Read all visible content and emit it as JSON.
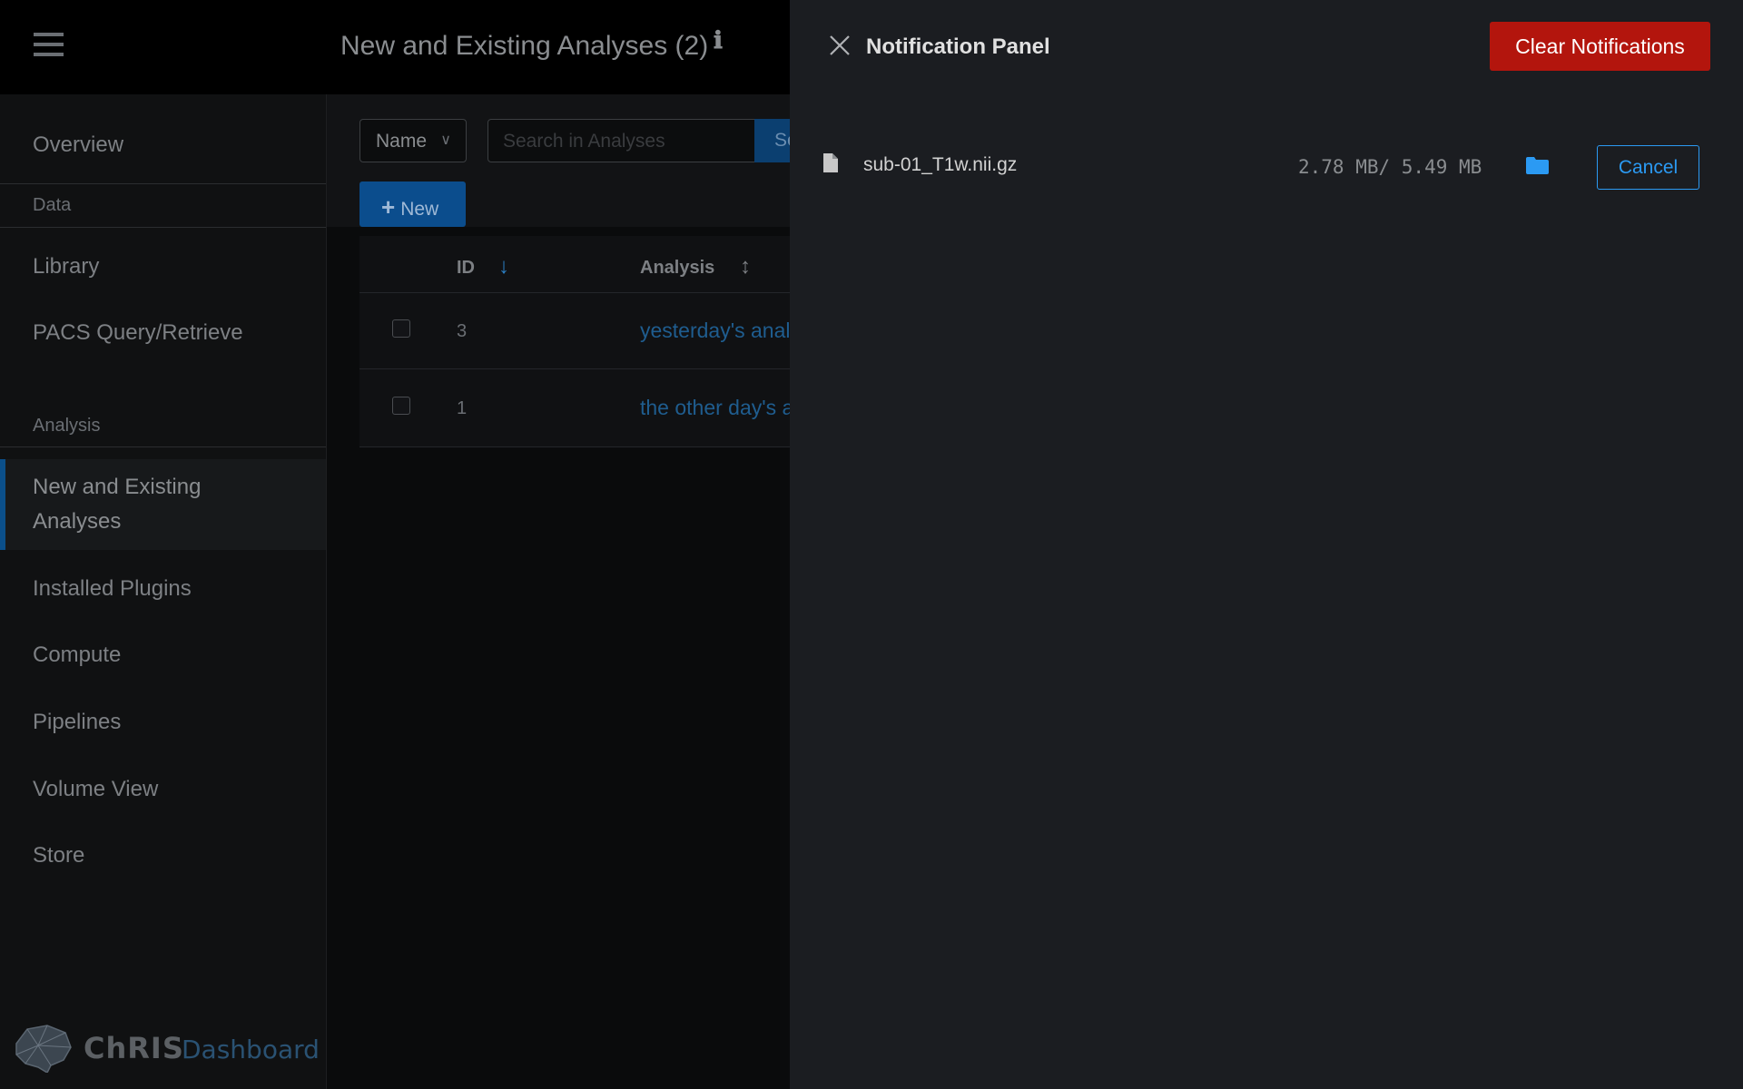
{
  "header": {
    "title": "New and Existing Analyses (2)",
    "info_icon": "ℹ"
  },
  "sidebar": {
    "items": [
      {
        "label": "Overview"
      },
      {
        "section": "Data"
      },
      {
        "label": "Library"
      },
      {
        "label": "PACS Query/Retrieve"
      },
      {
        "section": "Analysis"
      },
      {
        "label": "New and Existing Analyses",
        "active": true
      },
      {
        "label": "Installed Plugins"
      },
      {
        "label": "Compute"
      },
      {
        "label": "Pipelines"
      },
      {
        "label": "Volume View"
      },
      {
        "label": "Store"
      }
    ],
    "active_line1": "New and Existing",
    "active_line2": "Analyses",
    "logo_text": "ChRIS",
    "logo_sub": "Dashboard"
  },
  "toolbar": {
    "filter_select": "Name",
    "search_placeholder": "Search in Analyses",
    "search_button": "Se",
    "new_button": "New"
  },
  "table": {
    "headers": {
      "id": "ID",
      "analysis": "Analysis"
    },
    "rows": [
      {
        "id": "3",
        "analysis": "yesterday's analysis"
      },
      {
        "id": "1",
        "analysis": "the other day's analysis"
      }
    ]
  },
  "notification_panel": {
    "title": "Notification Panel",
    "clear_button": "Clear Notifications",
    "items": [
      {
        "file_name": "sub-01_T1w.nii.gz",
        "progress_text": "2.78 MB/ 5.49 MB",
        "uploaded_mb": 2.78,
        "total_mb": 5.49,
        "action": "Cancel"
      }
    ]
  },
  "colors": {
    "accent_blue": "#2b9af3",
    "danger_red": "#b3150d",
    "panel_bg": "#1b1d21"
  }
}
